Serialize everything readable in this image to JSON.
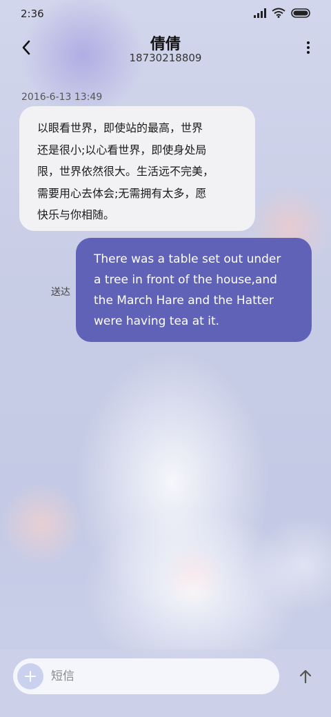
{
  "status_bar": {
    "time": "2:36",
    "icons": [
      "signal-icon",
      "wifi-icon",
      "battery-icon"
    ]
  },
  "header": {
    "contact_name": "倩倩",
    "phone_number": "18730218809",
    "back_icon": "chevron-left-icon",
    "menu_icon": "more-vertical-icon"
  },
  "conversation": {
    "timestamp": "2016-6-13 13:49",
    "incoming_message": "以眼看世界，即使站的最高，世界\n还是很小;以心看世界，即使身处局\n限，世界依然很大。生活远不完美，\n需要用心去体会;无需拥有太多，愿\n快乐与你相随。",
    "outgoing_message": "There was a table set out under\na tree in front of the house,and\nthe March Hare and the Hatter\nwere having tea at it.",
    "outgoing_status": "送达"
  },
  "composer": {
    "placeholder": "短信",
    "value": "",
    "add_icon": "plus-icon",
    "send_icon": "arrow-up-icon"
  },
  "colors": {
    "outgoing_bubble": "#6062b8",
    "incoming_bubble": "#f2f2f4",
    "add_button": "#c9d1ee"
  }
}
